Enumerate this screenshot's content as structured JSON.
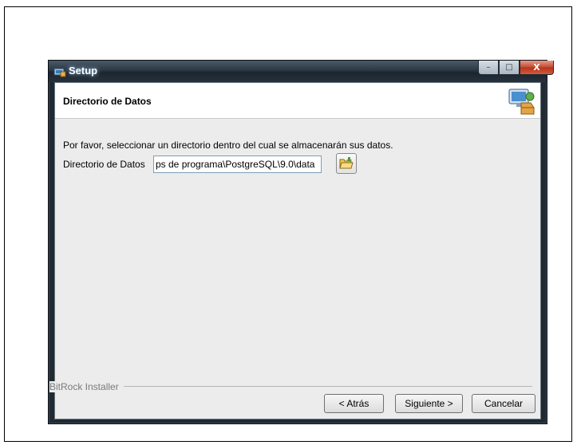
{
  "window": {
    "title": "Setup",
    "minimize_label": "–",
    "maximize_label": "□",
    "close_label": "X"
  },
  "header": {
    "title": "Directorio de Datos"
  },
  "content": {
    "instruction": "Por favor, seleccionar un directorio dentro del cual se almacenarán sus datos.",
    "dir_label": "Directorio de Datos",
    "dir_value": "ps de programa\\PostgreSQL\\9.0\\data"
  },
  "footer": {
    "installer_label": "BitRock Installer",
    "back_label": "< Atrás",
    "next_label": "Siguiente >",
    "cancel_label": "Cancelar"
  },
  "icons": {
    "app": "setup-icon",
    "header": "computer-install-icon",
    "browse": "folder-open-icon"
  }
}
